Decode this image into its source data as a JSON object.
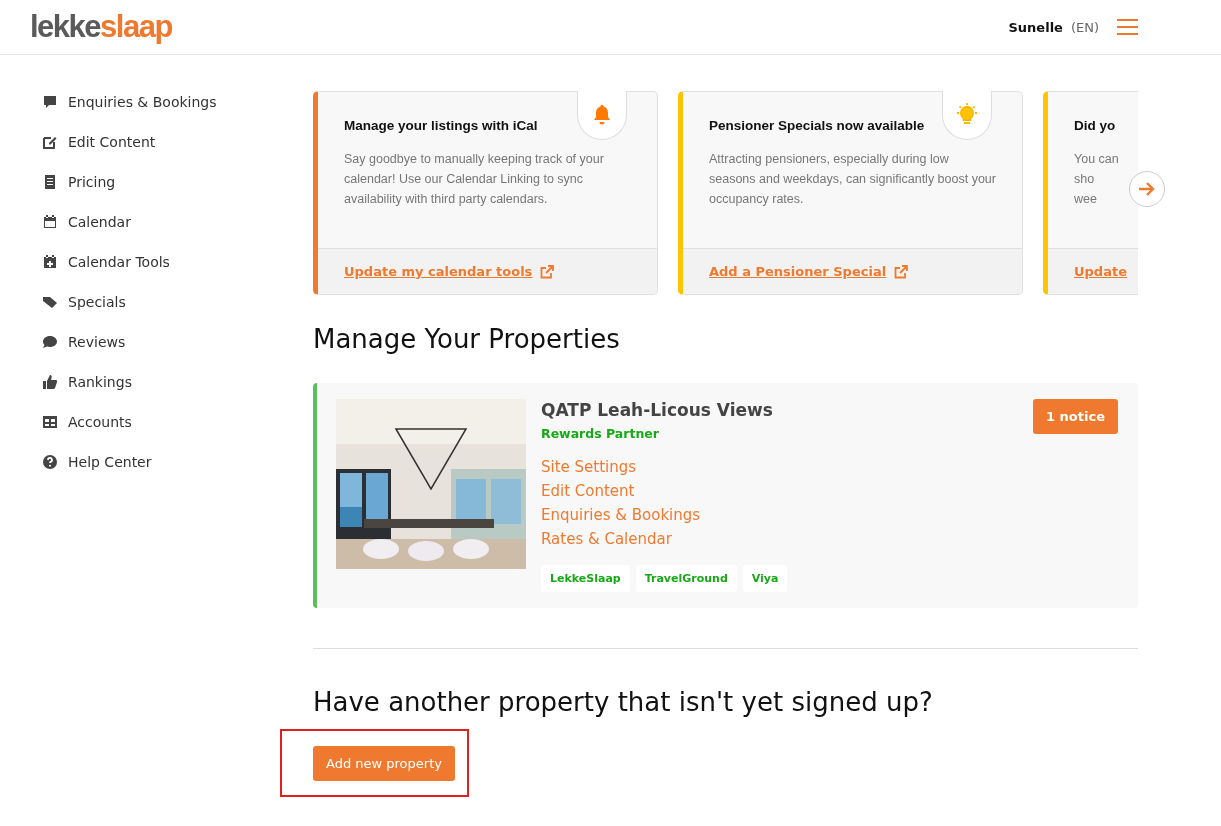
{
  "header": {
    "logo": {
      "first": "lekke",
      "second": "slaap"
    },
    "user": "Sunelle",
    "language": "(EN)"
  },
  "sidebar": {
    "items": [
      {
        "label": "Enquiries & Bookings"
      },
      {
        "label": "Edit Content"
      },
      {
        "label": "Pricing"
      },
      {
        "label": "Calendar"
      },
      {
        "label": "Calendar Tools"
      },
      {
        "label": "Specials"
      },
      {
        "label": "Reviews"
      },
      {
        "label": "Rankings"
      },
      {
        "label": "Accounts"
      },
      {
        "label": "Help Center"
      }
    ]
  },
  "promo_cards": [
    {
      "title": "Manage your listings with iCal",
      "body": "Say goodbye to manually keeping track of your\ncalendar! Use our Calendar Linking to sync\navailability with third party calendars.",
      "link": "Update my calendar tools",
      "kind": "bell",
      "color": "#ef7a2f"
    },
    {
      "title": "Pensioner Specials now available",
      "body": "Attracting pensioners, especially during low\nseasons and weekdays, can significantly boost your\noccupancy rates.",
      "link": "Add a Pensioner Special",
      "kind": "bulb",
      "color": "#ffc400"
    },
    {
      "title": "Did yo",
      "body": "You can\nsho\nwee",
      "link": "Update",
      "kind": "plain",
      "color": "#ffc400"
    }
  ],
  "properties_heading": "Manage Your Properties",
  "properties": [
    {
      "name": "QATP Leah-Licous Views",
      "tier": "Rewards Partner",
      "notice": "1 notice",
      "links": [
        "Site Settings",
        "Edit Content",
        "Enquiries & Bookings",
        "Rates & Calendar"
      ],
      "channels": [
        "LekkeSlaap",
        "TravelGround",
        "Viya"
      ]
    }
  ],
  "signup": {
    "heading": "Have another property that isn't yet signed up?",
    "button": "Add new property",
    "highlighted": true
  }
}
